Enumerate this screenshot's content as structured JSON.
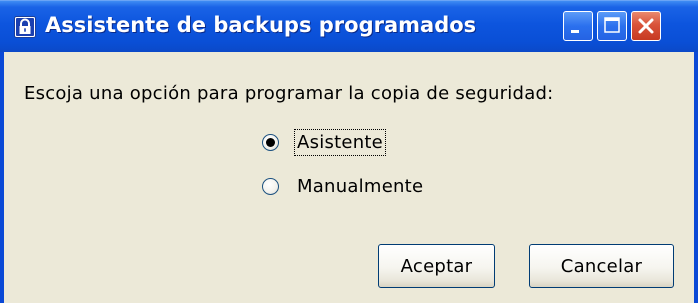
{
  "window": {
    "title": "Assistente de backups programados",
    "icon": "lock-icon",
    "controls": {
      "minimize_icon": "minimize-icon",
      "maximize_icon": "maximize-icon",
      "close_icon": "close-icon"
    }
  },
  "content": {
    "prompt": "Escoja una opción para programar la copia de seguridad:",
    "options": [
      {
        "label": "Asistente",
        "selected": true
      },
      {
        "label": "Manualmente",
        "selected": false
      }
    ]
  },
  "buttons": {
    "accept_label": "Aceptar",
    "cancel_label": "Cancelar"
  },
  "colors": {
    "titlebar": "#0a4fd6",
    "close_button": "#d9533a",
    "dialog_background": "#ece9d8"
  }
}
